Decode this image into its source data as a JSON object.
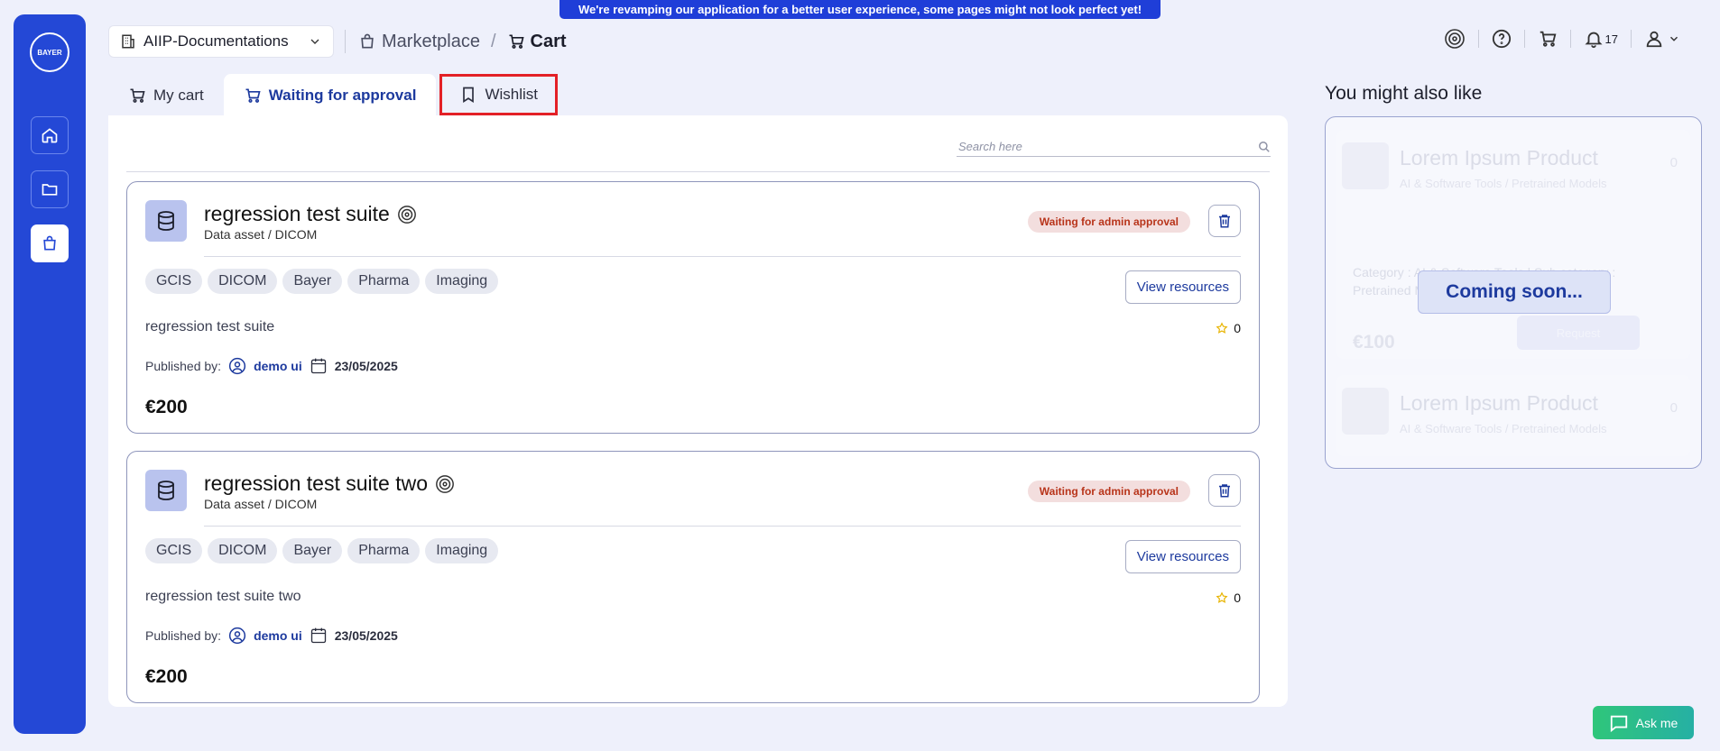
{
  "banner": {
    "text": "We're revamping our application for a better user experience, some pages might not look perfect yet!"
  },
  "sidebar": {
    "logo_text": "BAYER",
    "items": [
      {
        "icon": "home-icon"
      },
      {
        "icon": "folder-icon"
      },
      {
        "icon": "bag-icon",
        "active": true
      }
    ]
  },
  "topbar": {
    "workspace": "AIIP-Documentations",
    "breadcrumb": {
      "marketplace": "Marketplace",
      "current": "Cart"
    },
    "notifications_count": "17"
  },
  "tabs": [
    {
      "label": "My cart",
      "icon": "cart-icon"
    },
    {
      "label": "Waiting for approval",
      "icon": "cart-icon",
      "active": true
    },
    {
      "label": "Wishlist",
      "icon": "bookmark-icon",
      "highlighted": true
    }
  ],
  "search": {
    "placeholder": "Search here"
  },
  "cards": [
    {
      "title": "regression test suite",
      "subtitle": "Data asset / DICOM",
      "status": "Waiting for admin approval",
      "tags": [
        "GCIS",
        "DICOM",
        "Bayer",
        "Pharma",
        "Imaging"
      ],
      "view_resources": "View resources",
      "description": "regression test suite",
      "rating": "0",
      "published_label": "Published by:",
      "author": "demo ui",
      "date": "23/05/2025",
      "price": "€200"
    },
    {
      "title": "regression test suite two",
      "subtitle": "Data asset / DICOM",
      "status": "Waiting for admin approval",
      "tags": [
        "GCIS",
        "DICOM",
        "Bayer",
        "Pharma",
        "Imaging"
      ],
      "view_resources": "View resources",
      "description": "regression test suite two",
      "rating": "0",
      "published_label": "Published by:",
      "author": "demo ui",
      "date": "23/05/2025",
      "price": "€200"
    }
  ],
  "recommendations": {
    "title": "You might also like",
    "coming_soon": "Coming soon...",
    "ghost": {
      "title": "Lorem Ipsum Product",
      "sub": "AI & Software Tools / Pretrained Models",
      "count": "0",
      "category": "Category : AI & Software Tools | Sub category : Pretrained Models",
      "price": "€100",
      "request": "Request"
    }
  },
  "askme": {
    "label": "Ask me"
  },
  "colors": {
    "primary": "#2448d6",
    "accent": "#1d3a9e",
    "status_bg": "#f3dede",
    "status_text": "#b8341a",
    "highlight": "#e32026"
  }
}
